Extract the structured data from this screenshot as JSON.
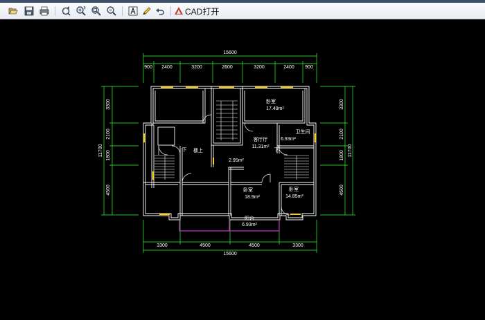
{
  "toolbar": {
    "buttons": [
      {
        "name": "open-folder-icon"
      },
      {
        "name": "save-icon"
      },
      {
        "name": "print-icon"
      },
      {
        "name": "pan-icon"
      },
      {
        "name": "zoom-in-icon"
      },
      {
        "name": "zoom-window-icon"
      },
      {
        "name": "zoom-out-icon"
      },
      {
        "name": "text-icon"
      },
      {
        "name": "pencil-icon"
      },
      {
        "name": "undo-icon"
      }
    ],
    "cad_open_label": "CAD打开",
    "accent": "#c0392b"
  },
  "drawing": {
    "top_total": "15600",
    "top_dims": [
      "900",
      "2400",
      "3200",
      "2600",
      "3200",
      "2400",
      "900"
    ],
    "bottom_dims": [
      "3300",
      "4500",
      "4500",
      "3300"
    ],
    "bottom_total": "15600",
    "left_dims": [
      "3300",
      "2100",
      "1800",
      "4500"
    ],
    "left_total": "11700",
    "right_dims": [
      "3300",
      "2100",
      "1800",
      "4500"
    ],
    "right_total": "11700",
    "rooms": {
      "bedroom_top": "卧室",
      "bedroom_top_area": "17.49m²",
      "bathroom": "卫生间",
      "bathroom_area": "6.93m²",
      "living": "客厅厅",
      "living_area": "11.31m²",
      "small_area": "2.95m²",
      "stair_up": "楼上",
      "stair_down_left": "下",
      "stair_down_right": "下",
      "bedroom_mid": "卧室",
      "bedroom_mid_area": "18.9m²",
      "bedroom_right": "卧室",
      "bedroom_right_area": "14.85m²",
      "balcony": "阳台",
      "balcony_area": "6.93m²"
    },
    "colors": {
      "wall": "#ffffff",
      "dimension": "#30ff30",
      "window": "#ffd200",
      "door": "#ffffff",
      "balcony_rail": "#c034c8"
    }
  }
}
